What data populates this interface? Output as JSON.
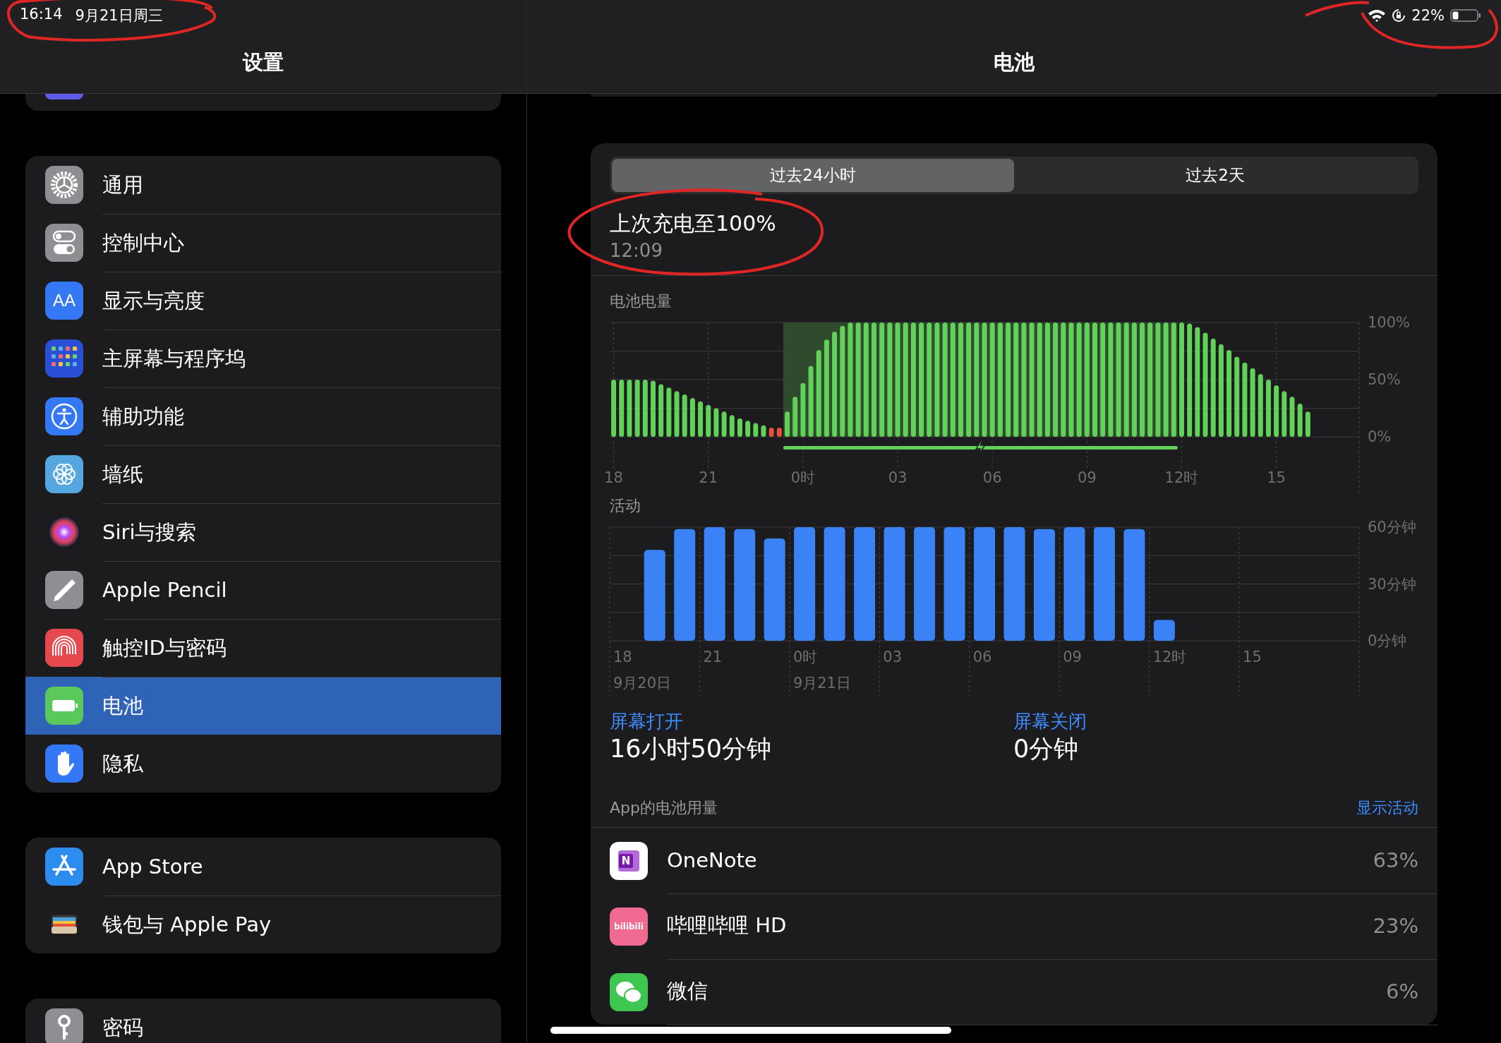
{
  "status_bar": {
    "time": "16:14",
    "date": "9月21日周三",
    "battery_percent": "22%"
  },
  "sidebar": {
    "title": "设置",
    "groups": [
      {
        "items": [
          {
            "kind": "general",
            "label": "通用",
            "selected": false
          },
          {
            "kind": "control",
            "label": "控制中心",
            "selected": false
          },
          {
            "kind": "display",
            "label": "显示与亮度",
            "icon_text": "AA",
            "selected": false
          },
          {
            "kind": "home",
            "label": "主屏幕与程序坞",
            "selected": false
          },
          {
            "kind": "accessibility",
            "label": "辅助功能",
            "selected": false
          },
          {
            "kind": "wallpaper",
            "label": "墙纸",
            "selected": false
          },
          {
            "kind": "siri",
            "label": "Siri与搜索",
            "selected": false
          },
          {
            "kind": "pencil",
            "label": "Apple Pencil",
            "selected": false
          },
          {
            "kind": "touchid",
            "label": "触控ID与密码",
            "selected": false
          },
          {
            "kind": "battery",
            "label": "电池",
            "selected": true
          },
          {
            "kind": "privacy",
            "label": "隐私",
            "selected": false
          }
        ]
      },
      {
        "items": [
          {
            "kind": "appstore",
            "label": "App Store",
            "selected": false
          },
          {
            "kind": "wallet",
            "label": "钱包与 Apple Pay",
            "selected": false
          }
        ]
      },
      {
        "items": [
          {
            "kind": "passwords",
            "label": "密码",
            "selected": false
          }
        ]
      }
    ]
  },
  "detail": {
    "title": "电池",
    "segments": [
      {
        "label": "过去24小时",
        "selected": true
      },
      {
        "label": "过去2天",
        "selected": false
      }
    ],
    "last_charge": {
      "title": "上次充电至100%",
      "time": "12:09"
    },
    "battery_level": {
      "label": "电池电量",
      "chart_data": {
        "type": "bar",
        "grid": true,
        "ylim": [
          0,
          100
        ],
        "categories": [
          "18",
          null,
          null,
          null,
          null,
          null,
          null,
          null,
          null,
          null,
          null,
          null,
          "21",
          null,
          null,
          null,
          null,
          null,
          null,
          null,
          null,
          null,
          null,
          null,
          "0时",
          null,
          null,
          null,
          null,
          null,
          null,
          null,
          null,
          null,
          null,
          null,
          "03",
          null,
          null,
          null,
          null,
          null,
          null,
          null,
          null,
          null,
          null,
          null,
          "06",
          null,
          null,
          null,
          null,
          null,
          null,
          null,
          null,
          null,
          null,
          null,
          "09",
          null,
          null,
          null,
          null,
          null,
          null,
          null,
          null,
          null,
          null,
          null,
          "12时",
          null,
          null,
          null,
          null,
          null,
          null,
          null,
          null,
          null,
          null,
          null,
          "15",
          null,
          null,
          null,
          null,
          null,
          null,
          null,
          null,
          null,
          null
        ],
        "yticks": [
          {
            "value": 0,
            "label": "0%"
          },
          {
            "value": 50,
            "label": "50%"
          },
          {
            "value": 100,
            "label": "100%"
          }
        ],
        "series": [
          {
            "color": "#62d15a",
            "values": [
              50,
              50,
              50,
              50,
              50,
              49,
              46,
              43,
              40,
              37,
              34,
              31,
              28,
              25,
              22,
              19,
              16,
              14,
              12,
              10,
              null,
              null,
              22,
              35,
              47,
              62,
              76,
              85,
              92,
              97,
              100,
              100,
              100,
              100,
              100,
              100,
              100,
              100,
              100,
              100,
              100,
              100,
              100,
              100,
              100,
              100,
              100,
              100,
              100,
              100,
              100,
              100,
              100,
              100,
              100,
              100,
              100,
              100,
              100,
              100,
              100,
              100,
              100,
              100,
              100,
              100,
              100,
              100,
              100,
              100,
              100,
              100,
              100,
              99,
              96,
              91,
              86,
              81,
              76,
              70,
              65,
              60,
              55,
              50,
              45,
              40,
              35,
              29,
              22,
              null,
              null,
              null,
              null,
              null,
              null
            ]
          },
          {
            "color": "#e8503a",
            "values": [
              null,
              null,
              null,
              null,
              null,
              null,
              null,
              null,
              null,
              null,
              null,
              null,
              null,
              null,
              null,
              null,
              null,
              null,
              null,
              null,
              8,
              8,
              null,
              null,
              null,
              null,
              null,
              null,
              null,
              null,
              null,
              null,
              null,
              null,
              null,
              null,
              null,
              null,
              null,
              null,
              null,
              null,
              null,
              null,
              null,
              null,
              null,
              null,
              null,
              null,
              null,
              null,
              null,
              null,
              null,
              null,
              null,
              null,
              null,
              null,
              null,
              null,
              null,
              null,
              null,
              null,
              null,
              null,
              null,
              null,
              null,
              null,
              null,
              null,
              null,
              null,
              null,
              null,
              null,
              null,
              null,
              null,
              null,
              null,
              null,
              null,
              null,
              null,
              null,
              null,
              null,
              null,
              null,
              null,
              null
            ]
          }
        ]
      }
    },
    "activity": {
      "label": "活动",
      "chart_data": {
        "type": "bar",
        "grid": true,
        "ylim": [
          0,
          60
        ],
        "categories": [
          "18",
          null,
          null,
          "21",
          null,
          null,
          "0时",
          null,
          null,
          "03",
          null,
          null,
          "06",
          null,
          null,
          "09",
          null,
          null,
          "12时",
          null,
          null,
          "15",
          null,
          null,
          null
        ],
        "yticks": [
          {
            "value": 0,
            "label": "0分钟"
          },
          {
            "value": 30,
            "label": "30分钟"
          },
          {
            "value": 60,
            "label": "60分钟"
          }
        ],
        "series": [
          {
            "color": "#3b82f6",
            "values": [
              null,
              48,
              59,
              60,
              59,
              54,
              60,
              60,
              60,
              60,
              60,
              60,
              60,
              60,
              59,
              60,
              60,
              59,
              11,
              null,
              null,
              null,
              null,
              null,
              null
            ]
          }
        ],
        "annotations": [
          "9月20日",
          "9月21日"
        ]
      }
    },
    "screen_time": [
      {
        "label": "屏幕打开",
        "value": "16小时50分钟"
      },
      {
        "label": "屏幕关闭",
        "value": "0分钟"
      }
    ],
    "app_usage": {
      "title": "App的电池用量",
      "action": "显示活动",
      "apps": [
        {
          "kind": "onenote",
          "name": "OneNote",
          "icon_text": "N",
          "percent": "63%"
        },
        {
          "kind": "bilibili",
          "name": "哔哩哔哩 HD",
          "icon_text": "bilibili",
          "percent": "23%"
        },
        {
          "kind": "wechat",
          "name": "微信",
          "percent": "6%"
        }
      ]
    }
  }
}
